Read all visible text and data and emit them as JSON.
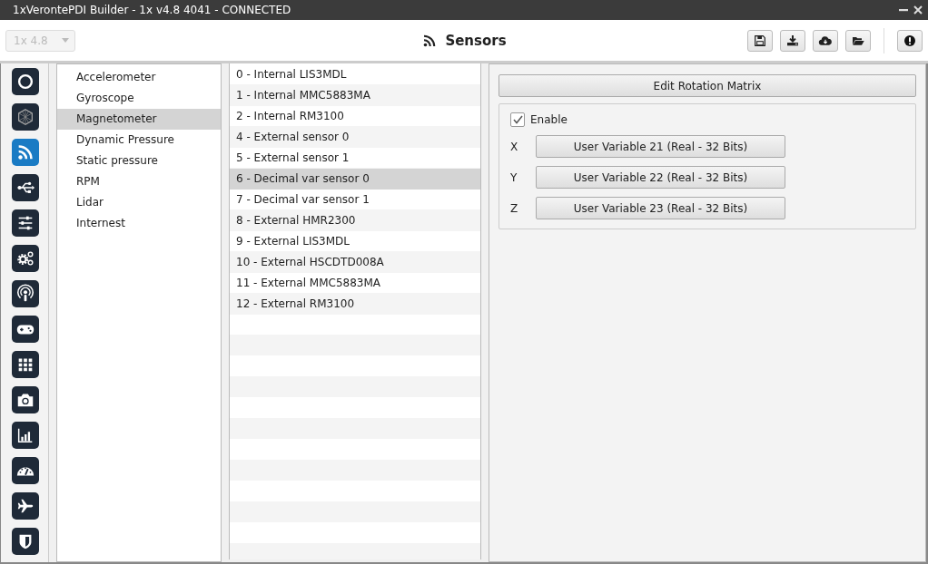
{
  "window": {
    "title": "1xVerontePDI Builder - 1x v4.8 4041 - CONNECTED"
  },
  "toolbar": {
    "version_select": {
      "value": "1x 4.8",
      "disabled": true
    },
    "title": "Sensors",
    "buttons": [
      {
        "kind": "save"
      },
      {
        "kind": "download"
      },
      {
        "kind": "cloud"
      },
      {
        "kind": "folder"
      },
      {
        "kind": "alert"
      }
    ]
  },
  "nav_rail": [
    {
      "kind": "ring",
      "selected": false
    },
    {
      "kind": "mesh",
      "selected": false
    },
    {
      "kind": "feed",
      "selected": true
    },
    {
      "kind": "usb",
      "selected": false
    },
    {
      "kind": "sliders",
      "selected": false
    },
    {
      "kind": "gears",
      "selected": false
    },
    {
      "kind": "podcast",
      "selected": false
    },
    {
      "kind": "gamepad",
      "selected": false
    },
    {
      "kind": "grid",
      "selected": false
    },
    {
      "kind": "camera",
      "selected": false
    },
    {
      "kind": "chart",
      "selected": false
    },
    {
      "kind": "gauge",
      "selected": false
    },
    {
      "kind": "plane",
      "selected": false
    },
    {
      "kind": "shield",
      "selected": false
    }
  ],
  "categories": [
    {
      "label": "Accelerometer",
      "selected": false
    },
    {
      "label": "Gyroscope",
      "selected": false
    },
    {
      "label": "Magnetometer",
      "selected": true
    },
    {
      "label": "Dynamic Pressure",
      "selected": false
    },
    {
      "label": "Static pressure",
      "selected": false
    },
    {
      "label": "RPM",
      "selected": false
    },
    {
      "label": "Lidar",
      "selected": false
    },
    {
      "label": "Internest",
      "selected": false
    }
  ],
  "sensors": [
    {
      "label": "0 - Internal LIS3MDL",
      "selected": false
    },
    {
      "label": "1 - Internal MMC5883MA",
      "selected": false
    },
    {
      "label": "2 - Internal RM3100",
      "selected": false
    },
    {
      "label": "4 - External sensor 0",
      "selected": false
    },
    {
      "label": "5 - External sensor 1",
      "selected": false
    },
    {
      "label": "6 - Decimal var sensor 0",
      "selected": true
    },
    {
      "label": "7 - Decimal var sensor 1",
      "selected": false
    },
    {
      "label": "8 - External HMR2300",
      "selected": false
    },
    {
      "label": "9 - External LIS3MDL",
      "selected": false
    },
    {
      "label": "10 - External HSCDTD008A",
      "selected": false
    },
    {
      "label": "11 - External MMC5883MA",
      "selected": false
    },
    {
      "label": "12 - External RM3100",
      "selected": false
    }
  ],
  "detail": {
    "edit_button": "Edit Rotation Matrix",
    "enable": {
      "label": "Enable",
      "checked": true
    },
    "axes": [
      {
        "label": "X",
        "value": "User Variable 21 (Real - 32 Bits)"
      },
      {
        "label": "Y",
        "value": "User Variable 22 (Real - 32 Bits)"
      },
      {
        "label": "Z",
        "value": "User Variable 23 (Real - 32 Bits)"
      }
    ]
  }
}
